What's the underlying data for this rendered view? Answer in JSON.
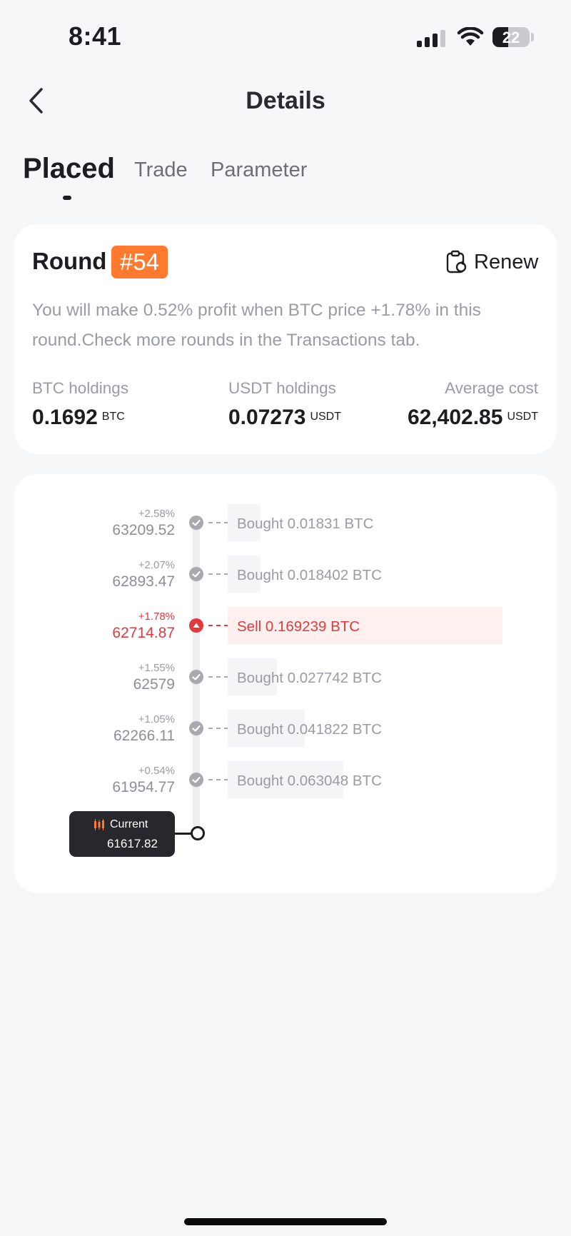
{
  "status_bar": {
    "time": "8:41",
    "battery": "22"
  },
  "nav": {
    "title": "Details"
  },
  "tabs": [
    {
      "label": "Placed",
      "active": true
    },
    {
      "label": "Trade",
      "active": false
    },
    {
      "label": "Parameter",
      "active": false
    }
  ],
  "round": {
    "label": "Round",
    "number": "#54",
    "renew_label": "Renew",
    "description": "You will make 0.52% profit when BTC price +1.78% in this round.Check more rounds in the Transactions tab.",
    "stats": [
      {
        "label": "BTC holdings",
        "value": "0.1692",
        "unit": "BTC"
      },
      {
        "label": "USDT holdings",
        "value": "0.07273",
        "unit": "USDT"
      },
      {
        "label": "Average cost",
        "value": "62,402.85",
        "unit": "USDT"
      }
    ]
  },
  "levels": [
    {
      "pct": "+2.58%",
      "price": "63209.52",
      "order": "Bought 0.01831 BTC",
      "type": "filled",
      "fill": 0.12
    },
    {
      "pct": "+2.07%",
      "price": "62893.47",
      "order": "Bought 0.018402 BTC",
      "type": "filled",
      "fill": 0.12
    },
    {
      "pct": "+1.78%",
      "price": "62714.87",
      "order": "Sell 0.169239 BTC",
      "type": "sell",
      "fill": 1.0
    },
    {
      "pct": "+1.55%",
      "price": "62579",
      "order": "Bought 0.027742 BTC",
      "type": "filled",
      "fill": 0.18
    },
    {
      "pct": "+1.05%",
      "price": "62266.11",
      "order": "Bought 0.041822 BTC",
      "type": "filled",
      "fill": 0.28
    },
    {
      "pct": "+0.54%",
      "price": "61954.77",
      "order": "Bought 0.063048 BTC",
      "type": "filled",
      "fill": 0.42
    }
  ],
  "current": {
    "label": "Current",
    "price": "61617.82"
  },
  "colors": {
    "accent": "#ff7a2e",
    "sell": "#e03a3e",
    "filled": "#a8aab0"
  }
}
